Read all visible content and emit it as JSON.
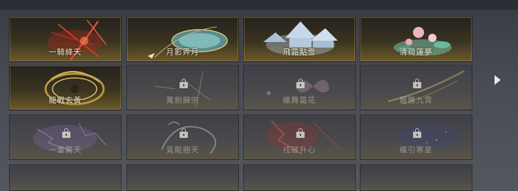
{
  "skins": {
    "items": [
      {
        "name": "一騎絳天",
        "status": "unlocked",
        "icon": "red-sword-slash-icon"
      },
      {
        "name": "月影弄月",
        "status": "unlocked",
        "icon": "jade-disc-icon"
      },
      {
        "name": "飛霜點雪",
        "status": "unlocked",
        "icon": "frost-pavilion-icon"
      },
      {
        "name": "清荷蓮夢",
        "status": "unlocked",
        "icon": "lotus-icon"
      },
      {
        "name": "龍戰玄黃",
        "status": "unlocked",
        "icon": "golden-dragon-icon"
      },
      {
        "name": "萬劍歸宗",
        "status": "locked",
        "icon": "sword-swarm-icon"
      },
      {
        "name": "蝶舞霜花",
        "status": "locked",
        "icon": "butterfly-icon"
      },
      {
        "name": "龍騰九霄",
        "status": "locked",
        "icon": "gold-dragon-flight-icon"
      },
      {
        "name": "一雷驚天",
        "status": "locked",
        "icon": "lightning-icon"
      },
      {
        "name": "覓龍捆天",
        "status": "locked",
        "icon": "dragon-coil-icon"
      },
      {
        "name": "戌破升心",
        "status": "locked",
        "icon": "crimson-lightning-icon"
      },
      {
        "name": "蝶引寒星",
        "status": "locked",
        "icon": "starry-swirl-icon"
      }
    ]
  },
  "navigation": {
    "next_icon": "chevron-right-icon"
  },
  "colors": {
    "unlocked_bg": "#6b5a2a",
    "locked_bg": "#4a4a4c",
    "label_text": "#f1ead6"
  }
}
